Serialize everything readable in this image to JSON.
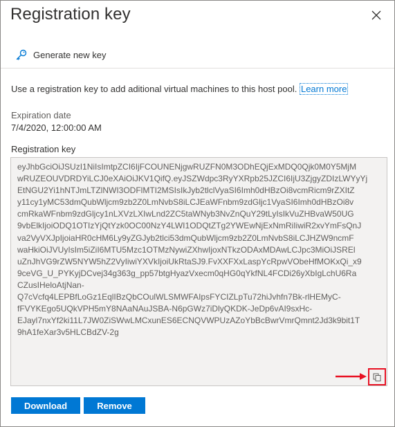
{
  "panel": {
    "title": "Registration key",
    "close_icon": "close-icon"
  },
  "toolbar": {
    "generate_label": "Generate new key",
    "generate_icon": "key-icon"
  },
  "description": {
    "text": "Use a registration key to add aditional virtual machines to this host pool.",
    "link_text": "Learn more"
  },
  "expiration": {
    "label": "Expiration date",
    "value": "7/4/2020, 12:00:00 AM"
  },
  "registration_key": {
    "label": "Registration key",
    "lines": [
      "eyJhbGciOiJSUzI1NiIsImtpZCI6IjFCOUNENjgwRUZFN0M3ODhEQjExMDQ0Qjk0M0Y5MjM",
      "wRUZEOUVDRDYiLCJ0eXAiOiJKV1QifQ.eyJSZWdpc3RyYXRpb25JZCI6IjU3ZjgyZDIzLWYyYj",
      "EtNGU2Yi1hNTJmLTZlNWI3ODFlMTI2MSIsIkJyb2tlclVyaSI6Imh0dHBzOi8vcmRicm9rZXItZ",
      "y11cy1yMC53dmQubWljcm9zb2Z0LmNvbS8iLCJEaWFnbm9zdGljc1VyaSI6Imh0dHBzOi8v",
      "cmRkaWFnbm9zdGljcy1nLXVzLXIwLnd2ZC5taWNyb3NvZnQuY29tLyIsIkVuZHBvaW50UG",
      "9vbElkIjoiODQ1OTIzYjQtYzk0OC00NzY4LWI1ODQtZTg2YWEwNjExNmRiIiwiR2xvYmFsQnJ",
      "va2VyVXJpIjoiaHR0cHM6Ly9yZGJyb2tlci53dmQubWljcm9zb2Z0LmNvbS8iLCJHZW9ncmF",
      "waHkiOiJVUyIsIm5iZiI6MTU5Mzc1OTMzNywiZXhwIjoxNTkzODAxMDAwLCJpc3MiOiJSREl",
      "uZnJhVG9rZW5NYW5hZ2VyIiwiYXVkIjoiUkRtaSJ9.FvXXFXxLaspYcRpwVObeHfMOKxQi_x9",
      "9ceVG_U_PYKyjDCvej34g363g_pp57btgHyazVxecm0qHG0qYkfNL4FCDi26yXbIgLchU6Ra",
      "CZusIHeloAtjNan-",
      "Q7cVcfq4LEPBfLoGz1EqlIBzQbCOulWLSMWFAIpsFYCIZLpTu72hiJvhfn7Bk-rlHEMyC-",
      "fFVYKEgo5UQkVPH5mY8NAaNAuJSBA-N6pGWz7iDlyQKDK-JeDp6vAI9sxHc-",
      "EJayl7nxYf2ki11L7JW0ZiSWwLMCxunES6ECNQVWPUzAZoYbBcBwrVmrQmnt2Jd3k9bit1T",
      "9hA1feXar3v5HLCBdZV-2g"
    ],
    "copy_icon": "copy-icon"
  },
  "actions": {
    "download_label": "Download",
    "remove_label": "Remove"
  },
  "colors": {
    "accent": "#0078d4",
    "highlight": "#e81123"
  }
}
